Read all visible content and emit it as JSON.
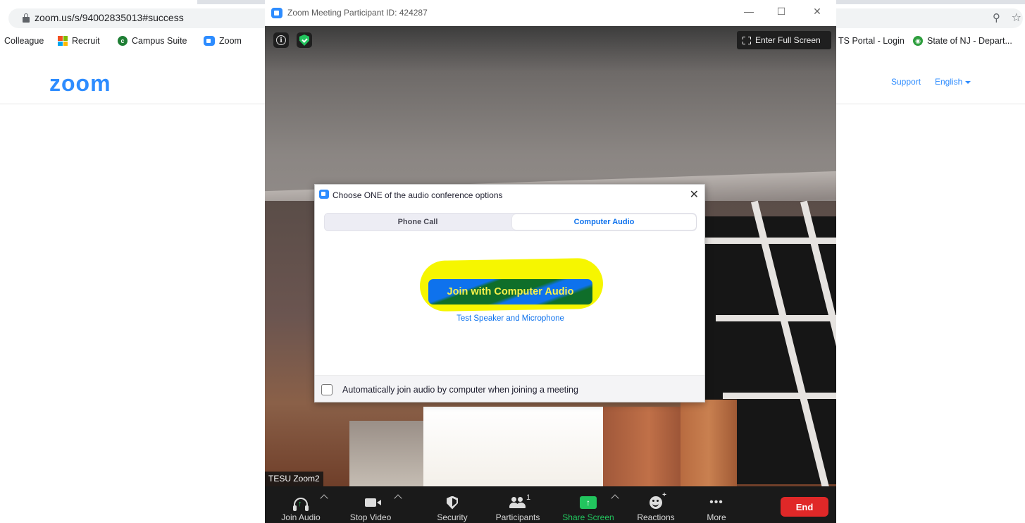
{
  "browser": {
    "url": "zoom.us/s/94002835013#success",
    "bookmarks": [
      "Colleague",
      "Recruit",
      "Campus Suite",
      "Zoom",
      "TS Portal - Login",
      "State of NJ - Depart..."
    ]
  },
  "zoom_site": {
    "logo": "zoom",
    "nav": {
      "support": "Support",
      "language": "English"
    }
  },
  "meeting_window": {
    "title": "Zoom Meeting Participant ID: 424287",
    "info_glyph": "i",
    "fullscreen_label": "Enter Full Screen",
    "participant_name": "TESU Zoom2",
    "toolbar": {
      "join_audio": "Join Audio",
      "stop_video": "Stop Video",
      "security": "Security",
      "participants": "Participants",
      "participant_count": "1",
      "share_screen": "Share Screen",
      "reactions": "Reactions",
      "more": "More",
      "end": "End"
    }
  },
  "audio_dialog": {
    "title": "Choose ONE of the audio conference options",
    "close_glyph": "✕",
    "tabs": [
      {
        "label": "Phone Call",
        "selected": false
      },
      {
        "label": "Computer Audio",
        "selected": true
      }
    ],
    "join_button": "Join with Computer Audio",
    "test_link": "Test Speaker and Microphone",
    "auto_join_checkbox": {
      "label": "Automatically join audio by computer when joining a meeting",
      "checked": false
    }
  },
  "colors": {
    "zoom_blue": "#2d8cff",
    "link_blue": "#0e72ed",
    "highlight_yellow": "#f6f600",
    "end_red": "#e02828",
    "share_green": "#22c55e"
  }
}
